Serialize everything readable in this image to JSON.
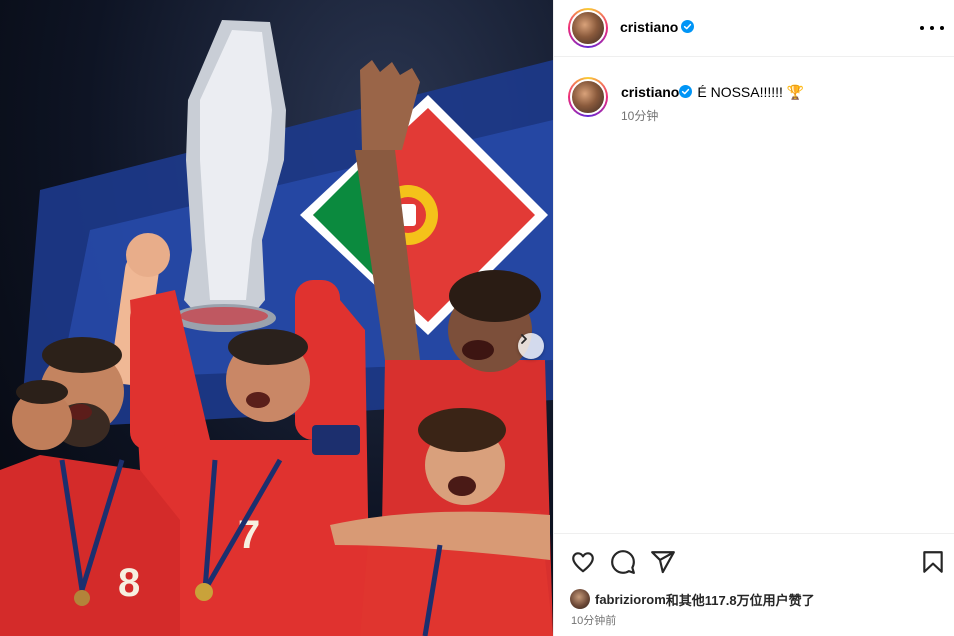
{
  "post": {
    "username": "cristiano",
    "caption": "É NOSSA!!!!!! 🏆",
    "time_short": "10分钟",
    "likes_by": "fabriziorom",
    "likes_text": "和其他117.8万位用户赞了",
    "time_posted": "10分钟前"
  },
  "icons": {
    "verified": "verified-badge-icon",
    "more": "more-options-icon",
    "like": "heart-icon",
    "comment": "comment-icon",
    "share": "share-icon",
    "save": "bookmark-icon",
    "next": "chevron-right-icon"
  },
  "colors": {
    "verified_blue": "#0095f6",
    "portugal_red": "#d8262e",
    "portugal_green": "#0b8a3e",
    "muted_text": "#737373",
    "divider": "#efefef"
  }
}
